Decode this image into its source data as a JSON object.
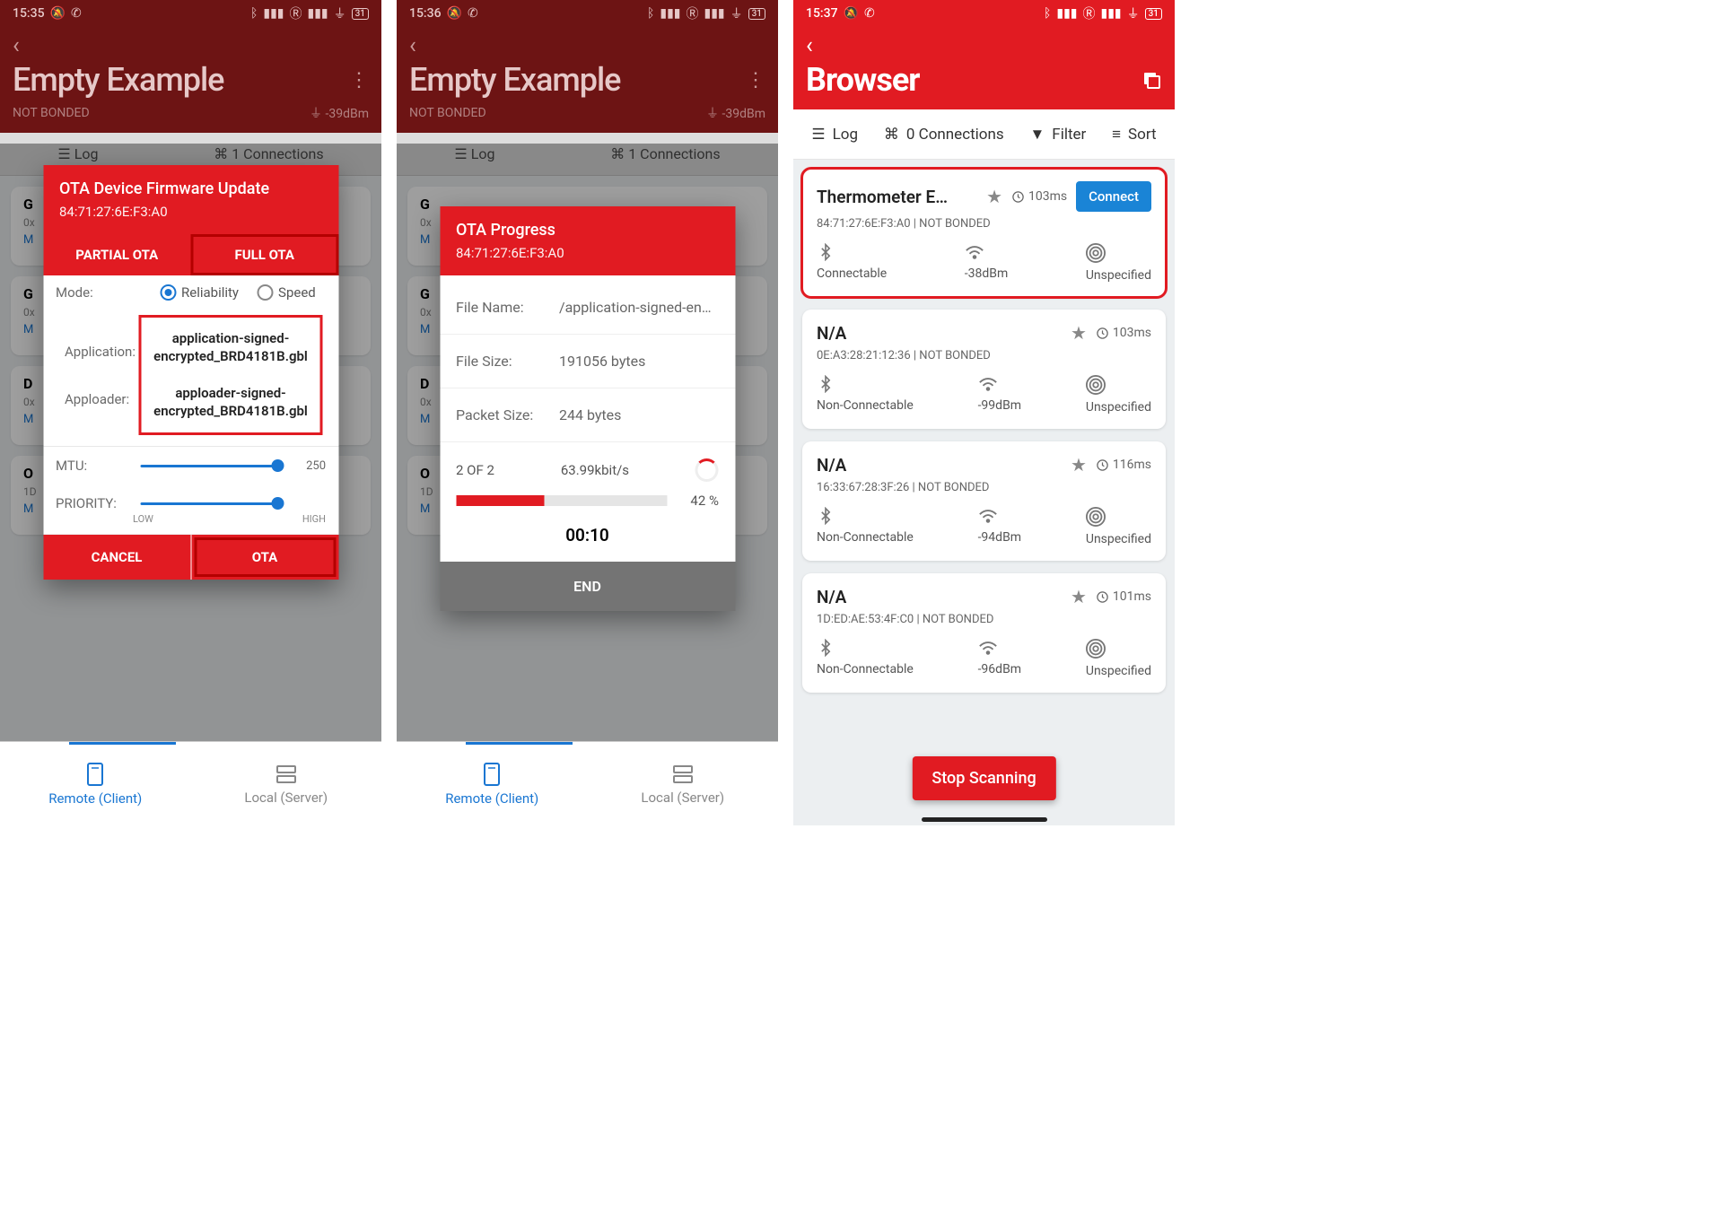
{
  "screens": {
    "s1": {
      "status_time": "15:35",
      "header_title": "Empty Example",
      "bond_status": "NOT BONDED",
      "rssi": "-39dBm",
      "tool_log": "Log",
      "tool_conn": "1 Connections",
      "dlg_title": "OTA Device Firmware Update",
      "dlg_mac": "84:71:27:6E:F3:A0",
      "tab_partial": "PARTIAL OTA",
      "tab_full": "FULL OTA",
      "mode_label": "Mode:",
      "mode_rel": "Reliability",
      "mode_speed": "Speed",
      "app_label": "Application:",
      "app_file": "application-signed-encrypted_BRD4181B.gbl",
      "loader_label": "Apploader:",
      "loader_file": "apploader-signed-encrypted_BRD4181B.gbl",
      "mtu_label": "MTU:",
      "mtu_val": "250",
      "prio_label": "PRIORITY:",
      "prio_low": "LOW",
      "prio_high": "HIGH",
      "btn_cancel": "CANCEL",
      "btn_ota": "OTA",
      "nav_remote": "Remote (Client)",
      "nav_local": "Local (Server)"
    },
    "s2": {
      "status_time": "15:36",
      "header_title": "Empty Example",
      "bond_status": "NOT BONDED",
      "rssi": "-39dBm",
      "tool_log": "Log",
      "tool_conn": "1 Connections",
      "dlg_title": "OTA Progress",
      "dlg_mac": "84:71:27:6E:F3:A0",
      "fn_label": "File Name:",
      "fn_val": "/application-signed-en…",
      "fs_label": "File Size:",
      "fs_val": "191056 bytes",
      "ps_label": "Packet Size:",
      "ps_val": "244 bytes",
      "step": "2 OF 2",
      "rate": "63.99kbit/s",
      "pct": "42 %",
      "pct_num": 42,
      "timer": "00:10",
      "end": "END",
      "nav_remote": "Remote (Client)",
      "nav_local": "Local (Server)"
    },
    "s3": {
      "status_time": "15:37",
      "header_title": "Browser",
      "f_log": "Log",
      "f_conn": "0 Connections",
      "f_filter": "Filter",
      "f_sort": "Sort",
      "stop": "Stop Scanning",
      "connect": "Connect",
      "devs": [
        {
          "name": "Thermometer E…",
          "mac": "84:71:27:6E:F3:A0 | NOT BONDED",
          "lat": "103ms",
          "conn": "Connectable",
          "rssi": "-38dBm",
          "beacon": "Unspecified",
          "hl": true,
          "connectBtn": true
        },
        {
          "name": "N/A",
          "mac": "0E:A3:28:21:12:36 | NOT BONDED",
          "lat": "103ms",
          "conn": "Non-Connectable",
          "rssi": "-99dBm",
          "beacon": "Unspecified"
        },
        {
          "name": "N/A",
          "mac": "16:33:67:28:3F:26 | NOT BONDED",
          "lat": "116ms",
          "conn": "Non-Connectable",
          "rssi": "-94dBm",
          "beacon": "Unspecified"
        },
        {
          "name": "N/A",
          "mac": "1D:ED:AE:53:4F:C0 | NOT BONDED",
          "lat": "101ms",
          "conn": "Non-Connectable",
          "rssi": "-96dBm",
          "beacon": "Unspecified"
        }
      ]
    }
  },
  "battery_label": "31"
}
